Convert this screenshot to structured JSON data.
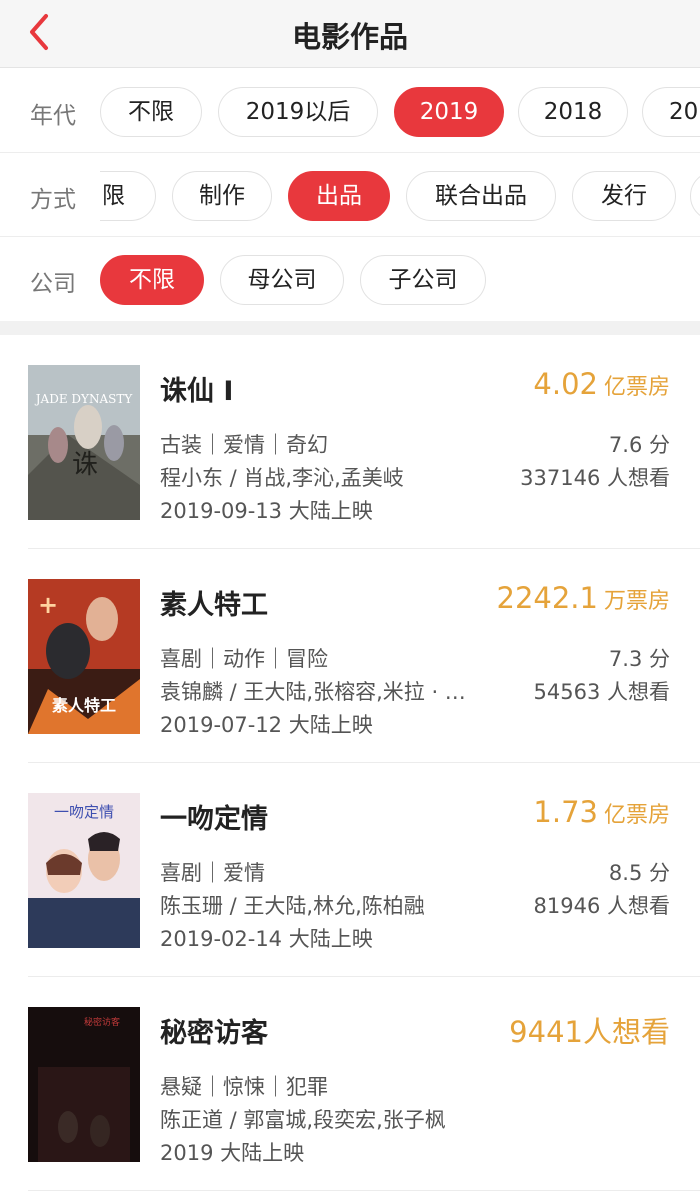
{
  "nav": {
    "title": "电影作品",
    "back_icon": "chevron-left-icon",
    "accent": "#e8383d"
  },
  "filters": {
    "era": {
      "label": "年代",
      "options": [
        "不限",
        "2019以后",
        "2019",
        "2018",
        "20"
      ],
      "selected": "2019"
    },
    "method": {
      "label": "方式",
      "options": [
        "限",
        "制作",
        "出品",
        "联合出品",
        "发行"
      ],
      "selected": "出品"
    },
    "company": {
      "label": "公司",
      "options": [
        "不限",
        "母公司",
        "子公司"
      ],
      "selected": "不限"
    }
  },
  "movies": [
    {
      "title": "诛仙 Ⅰ",
      "box_value": "4.02",
      "box_unit": "亿票房",
      "genres": "古装｜爱情｜奇幻",
      "people": "程小东 / 肖战,李沁,孟美岐",
      "rating": "7.6 分",
      "wants": "337146 人想看",
      "release": "2019-09-13 大陆上映",
      "poster_text": "JADE DYNASTY"
    },
    {
      "title": "素人特工",
      "box_value": "2242.1",
      "box_unit": "万票房",
      "genres": "喜剧｜动作｜冒险",
      "people": "袁锦麟 / 王大陆,张榕容,米拉 · …",
      "rating": "7.3 分",
      "wants": "54563 人想看",
      "release": "2019-07-12 大陆上映",
      "poster_text": "素人特工"
    },
    {
      "title": "一吻定情",
      "box_value": "1.73",
      "box_unit": "亿票房",
      "genres": "喜剧｜爱情",
      "people": "陈玉珊 / 王大陆,林允,陈柏融",
      "rating": "8.5 分",
      "wants": "81946 人想看",
      "release": "2019-02-14 大陆上映",
      "poster_text": "一吻定情"
    },
    {
      "title": "秘密访客",
      "box_value": "9441",
      "box_unit": "人想看",
      "genres": "悬疑｜惊悚｜犯罪",
      "people": "陈正道 / 郭富城,段奕宏,张子枫",
      "rating": "",
      "wants": "",
      "release": "2019 大陆上映",
      "poster_text": "秘密访客"
    }
  ]
}
